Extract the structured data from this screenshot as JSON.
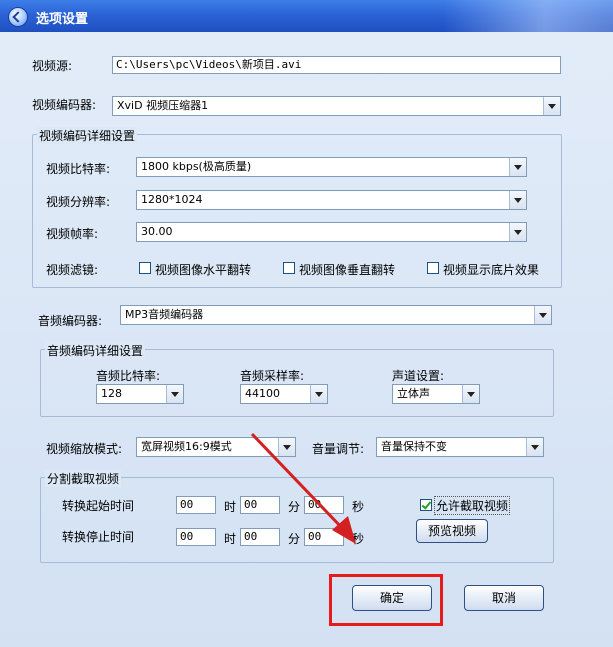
{
  "window": {
    "title": "选项设置"
  },
  "source": {
    "label": "视频源:",
    "value": "C:\\Users\\pc\\Videos\\新项目.avi"
  },
  "video_encoder": {
    "label": "视频编码器:",
    "value": "XviD 视频压缩器1"
  },
  "video_details": {
    "title": "视频编码详细设置",
    "bitrate": {
      "label": "视频比特率:",
      "value": "1800 kbps(极高质量)"
    },
    "resolution": {
      "label": "视频分辨率:",
      "value": "1280*1024"
    },
    "framerate": {
      "label": "视频帧率:",
      "value": "30.00"
    },
    "filter": {
      "label": "视频滤镜:",
      "hflip": {
        "label": "视频图像水平翻转",
        "checked": false
      },
      "vflip": {
        "label": "视频图像垂直翻转",
        "checked": false
      },
      "negative": {
        "label": "视频显示底片效果",
        "checked": false
      }
    }
  },
  "audio_encoder": {
    "label": "音频编码器:",
    "value": "MP3音频编码器"
  },
  "audio_details": {
    "title": "音频编码详细设置",
    "bitrate": {
      "label": "音频比特率:",
      "value": "128"
    },
    "samplerate": {
      "label": "音频采样率:",
      "value": "44100"
    },
    "channel": {
      "label": "声道设置:",
      "value": "立体声"
    }
  },
  "scale": {
    "label": "视频缩放模式:",
    "value": "宽屏视频16:9模式"
  },
  "volume": {
    "label": "音量调节:",
    "value": "音量保持不变"
  },
  "clip": {
    "title": "分割截取视频",
    "start": {
      "label": "转换起始时间",
      "h": "00",
      "m": "00",
      "s": "00"
    },
    "end": {
      "label": "转换停止时间",
      "h": "00",
      "m": "00",
      "s": "00"
    },
    "units": {
      "h": "时",
      "m": "分",
      "s": "秒"
    },
    "allow": {
      "label": "允许截取视频",
      "checked": true
    },
    "preview_label": "预览视频"
  },
  "buttons": {
    "ok": "确定",
    "cancel": "取消"
  },
  "colors": {
    "titlebar": "#2b63d6",
    "highlight": "#e81b1b",
    "arrow": "#d42020"
  }
}
